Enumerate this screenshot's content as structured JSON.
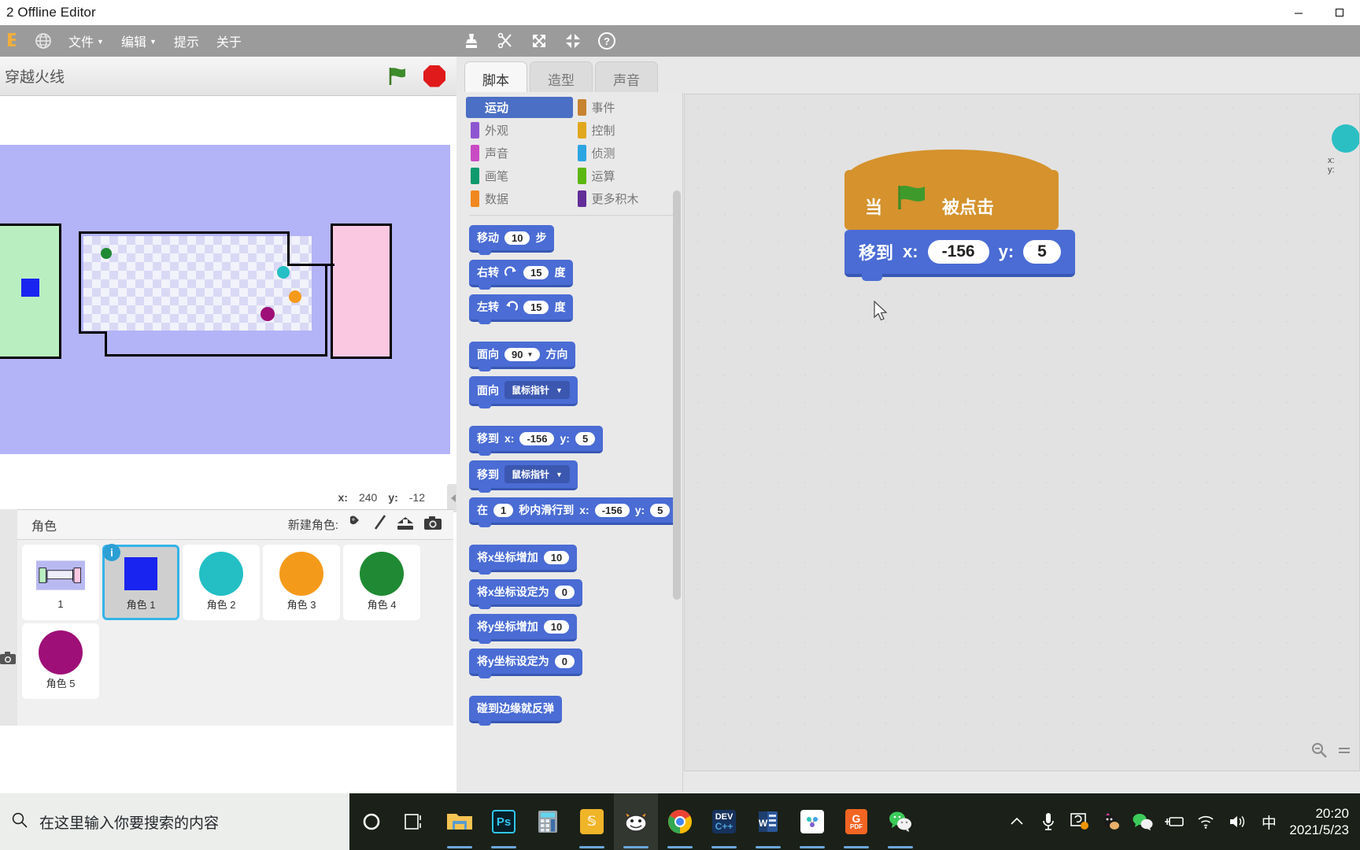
{
  "window": {
    "title": "2 Offline Editor",
    "controls": [
      "minimize-icon",
      "maximize-icon"
    ]
  },
  "menubar": {
    "logo_icon": "scratch-logo-icon",
    "globe_icon": "globe-icon",
    "items": [
      {
        "label": "文件",
        "has_caret": true
      },
      {
        "label": "编辑",
        "has_caret": true
      },
      {
        "label": "提示",
        "has_caret": false
      },
      {
        "label": "关于",
        "has_caret": false
      }
    ],
    "tools": [
      "stamp-icon",
      "scissors-icon",
      "grow-icon",
      "shrink-icon",
      "help-icon"
    ]
  },
  "stage": {
    "project_title": "穿越火线",
    "green_flag_icon": "green-flag-icon",
    "stop_icon": "stop-sign-icon",
    "mouse_x_label": "x:",
    "mouse_x_value": "240",
    "mouse_y_label": "y:",
    "mouse_y_value": "-12",
    "sprites_on_stage": [
      {
        "name": "角色 1",
        "color": "#1a24f0",
        "shape": "square"
      },
      {
        "name": "角色 4",
        "color": "#1f8a33",
        "shape": "circle"
      },
      {
        "name": "角色 2",
        "color": "#23bfc4",
        "shape": "circle"
      },
      {
        "name": "角色 3",
        "color": "#f49a1a",
        "shape": "circle"
      },
      {
        "name": "角色 5",
        "color": "#9e0f77",
        "shape": "circle"
      }
    ]
  },
  "sprite_panel": {
    "header_label": "角色",
    "new_sprite_label": "新建角色:",
    "new_sprite_icons": [
      "sprite-library-icon",
      "paint-brush-icon",
      "upload-icon",
      "camera-icon"
    ],
    "backdrop_icon": "camera-icon",
    "items": [
      {
        "name": "1",
        "type": "stage",
        "selected": false
      },
      {
        "name": "角色 1",
        "type": "sprite",
        "color": "#1a24f0",
        "shape": "square",
        "selected": true
      },
      {
        "name": "角色 2",
        "type": "sprite",
        "color": "#23bfc4",
        "shape": "circle",
        "selected": false
      },
      {
        "name": "角色 3",
        "type": "sprite",
        "color": "#f49a1a",
        "shape": "circle",
        "selected": false
      },
      {
        "name": "角色 4",
        "type": "sprite",
        "color": "#1f8a33",
        "shape": "circle",
        "selected": false
      },
      {
        "name": "角色 5",
        "type": "sprite",
        "color": "#9e0f77",
        "shape": "circle",
        "selected": false
      }
    ]
  },
  "editor": {
    "tabs": [
      {
        "label": "脚本",
        "active": true
      },
      {
        "label": "造型",
        "active": false
      },
      {
        "label": "声音",
        "active": false
      }
    ],
    "categories_left": [
      {
        "label": "运动",
        "color": "#4a6cd4",
        "active": true
      },
      {
        "label": "外观",
        "color": "#8e55d0",
        "active": false
      },
      {
        "label": "声音",
        "color": "#c94bc4",
        "active": false
      },
      {
        "label": "画笔",
        "color": "#0e9a6c",
        "active": false
      },
      {
        "label": "数据",
        "color": "#f1881f",
        "active": false
      }
    ],
    "categories_right": [
      {
        "label": "事件",
        "color": "#c88330",
        "active": false
      },
      {
        "label": "控制",
        "color": "#e1a81e",
        "active": false
      },
      {
        "label": "侦测",
        "color": "#2ca5e2",
        "active": false
      },
      {
        "label": "运算",
        "color": "#5cb712",
        "active": false
      },
      {
        "label": "更多积木",
        "color": "#632d99",
        "active": false
      }
    ],
    "palette_blocks": [
      {
        "id": "move-steps",
        "parts": [
          {
            "t": "text",
            "v": "移动"
          },
          {
            "t": "oval",
            "v": "10"
          },
          {
            "t": "text",
            "v": "步"
          }
        ]
      },
      {
        "id": "turn-right",
        "parts": [
          {
            "t": "text",
            "v": "右转"
          },
          {
            "t": "icon",
            "v": "turn-cw-icon"
          },
          {
            "t": "oval",
            "v": "15"
          },
          {
            "t": "text",
            "v": "度"
          }
        ]
      },
      {
        "id": "turn-left",
        "parts": [
          {
            "t": "text",
            "v": "左转"
          },
          {
            "t": "icon",
            "v": "turn-ccw-icon"
          },
          {
            "t": "oval",
            "v": "15"
          },
          {
            "t": "text",
            "v": "度"
          }
        ]
      },
      {
        "id": "point-direction",
        "gap_before": true,
        "parts": [
          {
            "t": "text",
            "v": "面向"
          },
          {
            "t": "ovalsel",
            "v": "90"
          },
          {
            "t": "text",
            "v": "方向"
          }
        ]
      },
      {
        "id": "point-towards",
        "parts": [
          {
            "t": "text",
            "v": "面向"
          },
          {
            "t": "drop",
            "v": "鼠标指针"
          }
        ]
      },
      {
        "id": "go-to-xy",
        "gap_before": true,
        "parts": [
          {
            "t": "text",
            "v": "移到"
          },
          {
            "t": "text",
            "v": "x:"
          },
          {
            "t": "oval",
            "v": "-156"
          },
          {
            "t": "text",
            "v": "y:"
          },
          {
            "t": "oval",
            "v": "5"
          }
        ]
      },
      {
        "id": "go-to-target",
        "parts": [
          {
            "t": "text",
            "v": "移到"
          },
          {
            "t": "drop",
            "v": "鼠标指针"
          }
        ]
      },
      {
        "id": "glide-secs-xy",
        "parts": [
          {
            "t": "text",
            "v": "在"
          },
          {
            "t": "oval",
            "v": "1"
          },
          {
            "t": "text",
            "v": "秒内滑行到"
          },
          {
            "t": "text",
            "v": "x:"
          },
          {
            "t": "oval",
            "v": "-156"
          },
          {
            "t": "text",
            "v": "y:"
          },
          {
            "t": "oval",
            "v": "5"
          }
        ]
      },
      {
        "id": "change-x-by",
        "gap_before": true,
        "parts": [
          {
            "t": "text",
            "v": "将x坐标增加"
          },
          {
            "t": "oval",
            "v": "10"
          }
        ]
      },
      {
        "id": "set-x-to",
        "parts": [
          {
            "t": "text",
            "v": "将x坐标设定为"
          },
          {
            "t": "oval",
            "v": "0"
          }
        ]
      },
      {
        "id": "change-y-by",
        "parts": [
          {
            "t": "text",
            "v": "将y坐标增加"
          },
          {
            "t": "oval",
            "v": "10"
          }
        ]
      },
      {
        "id": "set-y-to",
        "parts": [
          {
            "t": "text",
            "v": "将y坐标设定为"
          },
          {
            "t": "oval",
            "v": "0"
          }
        ]
      },
      {
        "id": "if-on-edge-bounce",
        "gap_before": true,
        "parts": [
          {
            "t": "text",
            "v": "碰到边缘就反弹"
          }
        ]
      }
    ],
    "script": {
      "hat": {
        "prefix": "当",
        "icon": "green-flag-icon",
        "suffix": "被点击"
      },
      "blocks": [
        {
          "id": "go-to-xy",
          "label": "移到",
          "x_label": "x:",
          "x_value": "-156",
          "y_label": "y:",
          "y_value": "5"
        }
      ]
    },
    "zoom_controls": [
      "zoom-out-icon",
      "zoom-reset-icon",
      "zoom-in-icon"
    ],
    "watcher": {
      "x_label": "x:",
      "y_label": "y:"
    }
  },
  "taskbar": {
    "search_placeholder": "在这里输入你要搜索的内容",
    "search_icon": "search-icon",
    "icons": [
      {
        "name": "cortana-icon",
        "open": false
      },
      {
        "name": "task-view-icon",
        "open": false
      },
      {
        "name": "file-explorer-icon",
        "open": true
      },
      {
        "name": "photoshop-icon",
        "open": true
      },
      {
        "name": "calculator-icon",
        "open": false
      },
      {
        "name": "everything-icon",
        "open": true
      },
      {
        "name": "scratch-icon",
        "open": true,
        "active": true
      },
      {
        "name": "chrome-icon",
        "open": true
      },
      {
        "name": "devcpp-icon",
        "open": true
      },
      {
        "name": "word-icon",
        "open": true
      },
      {
        "name": "baidu-netdisk-icon",
        "open": true
      },
      {
        "name": "pdf-icon",
        "open": true
      },
      {
        "name": "wechat-icon",
        "open": true
      }
    ],
    "tray": [
      "chevron-up-icon",
      "microphone-icon",
      "screen-capture-icon",
      "qq-icon",
      "wechat-tray-icon",
      "battery-icon",
      "wifi-icon",
      "volume-icon"
    ],
    "ime_label": "中",
    "time": "20:20",
    "date": "2021/5/23"
  }
}
